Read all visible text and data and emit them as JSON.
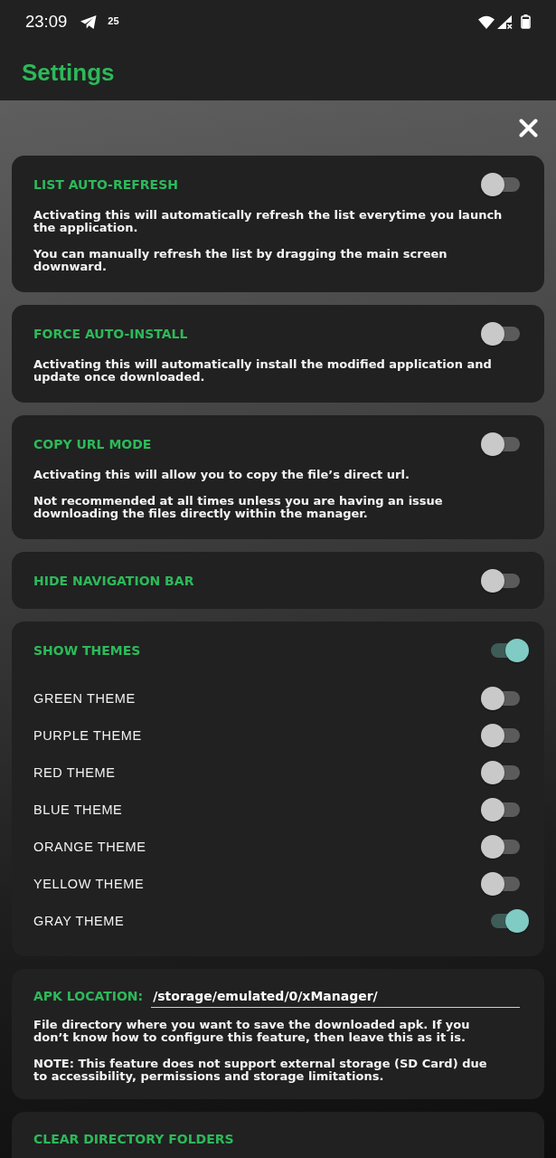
{
  "status_bar": {
    "time": "23:09",
    "notification_count": "25"
  },
  "app_bar": {
    "title": "Settings"
  },
  "settings": [
    {
      "kind": "toggle",
      "title": "LIST AUTO-REFRESH",
      "on": false,
      "paragraphs": [
        "Activating this will automatically refresh the list everytime you launch the application.",
        "You can manually refresh the list by dragging the main screen downward."
      ]
    },
    {
      "kind": "toggle",
      "title": "FORCE AUTO-INSTALL",
      "on": false,
      "paragraphs": [
        "Activating this will automatically install the modified application and update once downloaded."
      ]
    },
    {
      "kind": "toggle",
      "title": "COPY URL MODE",
      "on": false,
      "paragraphs": [
        "Activating this will allow you to copy the file’s direct url.",
        "Not recommended at all times unless you are having an issue downloading the files directly within the manager."
      ]
    },
    {
      "kind": "toggle",
      "title": "HIDE NAVIGATION BAR",
      "on": false
    },
    {
      "kind": "toggle_group",
      "title": "SHOW THEMES",
      "on": true,
      "options": [
        {
          "label": "GREEN THEME",
          "on": false
        },
        {
          "label": "PURPLE THEME",
          "on": false
        },
        {
          "label": "RED THEME",
          "on": false
        },
        {
          "label": "BLUE THEME",
          "on": false
        },
        {
          "label": "ORANGE THEME",
          "on": false
        },
        {
          "label": "YELLOW THEME",
          "on": false
        },
        {
          "label": "GRAY THEME",
          "on": true
        }
      ]
    },
    {
      "kind": "path",
      "label": "APK LOCATION:",
      "value": "/storage/emulated/0/xManager/",
      "paragraphs": [
        "File directory where you want to save the downloaded apk. If you don’t know how to configure this feature, then leave this as it is.",
        "NOTE: This feature does not support external storage (SD Card) due to accessibility, permissions and storage limitations."
      ]
    },
    {
      "kind": "header",
      "title": "CLEAR DIRECTORY FOLDERS"
    }
  ]
}
